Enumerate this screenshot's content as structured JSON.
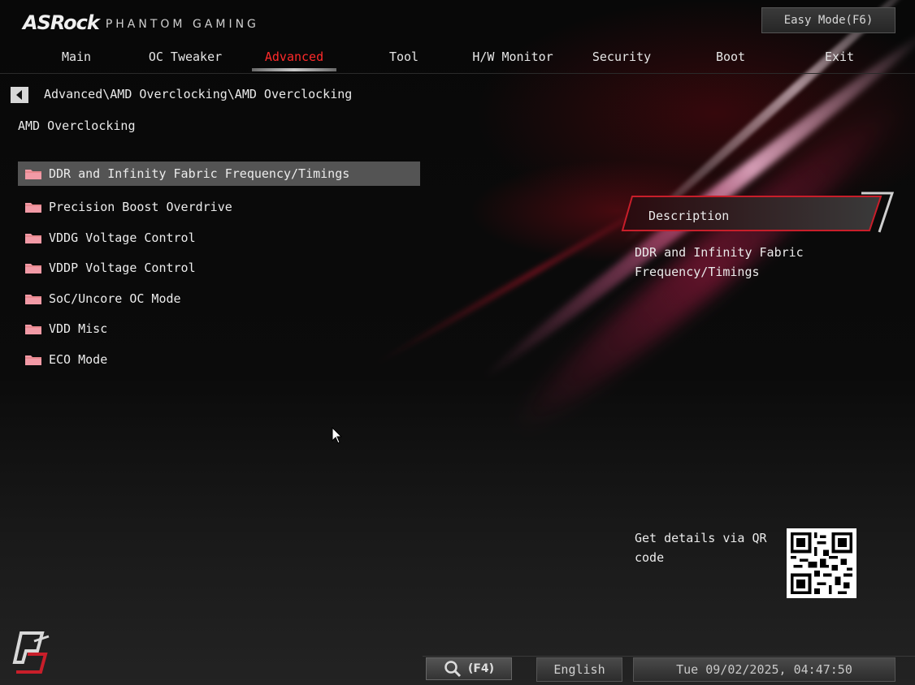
{
  "header": {
    "brand": "ASRock",
    "brand_sub": "PHANTOM GAMING",
    "easy_mode_label": "Easy Mode(F6)"
  },
  "tabs": [
    {
      "label": "Main",
      "active": false
    },
    {
      "label": "OC Tweaker",
      "active": false
    },
    {
      "label": "Advanced",
      "active": true
    },
    {
      "label": "Tool",
      "active": false
    },
    {
      "label": "H/W Monitor",
      "active": false
    },
    {
      "label": "Security",
      "active": false
    },
    {
      "label": "Boot",
      "active": false
    },
    {
      "label": "Exit",
      "active": false
    }
  ],
  "breadcrumb": "Advanced\\AMD Overclocking\\AMD Overclocking",
  "page_title": "AMD Overclocking",
  "menu": [
    {
      "label": "DDR and Infinity Fabric Frequency/Timings",
      "selected": true,
      "icon": "folder-icon"
    },
    {
      "label": "Precision Boost Overdrive",
      "selected": false,
      "icon": "folder-icon"
    },
    {
      "label": "VDDG Voltage Control",
      "selected": false,
      "icon": "folder-icon"
    },
    {
      "label": "VDDP Voltage Control",
      "selected": false,
      "icon": "folder-icon"
    },
    {
      "label": "SoC/Uncore OC Mode",
      "selected": false,
      "icon": "folder-icon"
    },
    {
      "label": "VDD Misc",
      "selected": false,
      "icon": "folder-icon"
    },
    {
      "label": "ECO Mode",
      "selected": false,
      "icon": "folder-icon"
    }
  ],
  "description": {
    "title": "Description",
    "text": "DDR and Infinity Fabric Frequency/Timings"
  },
  "qr": {
    "label": "Get details via QR code"
  },
  "footer": {
    "search_label": "(F4)",
    "language": "English",
    "datetime": "Tue 09/02/2025, 04:47:50"
  },
  "colors": {
    "accent": "#ff2a2a",
    "folder": "#f29aa6",
    "selected_row": "#6e6e6e"
  }
}
